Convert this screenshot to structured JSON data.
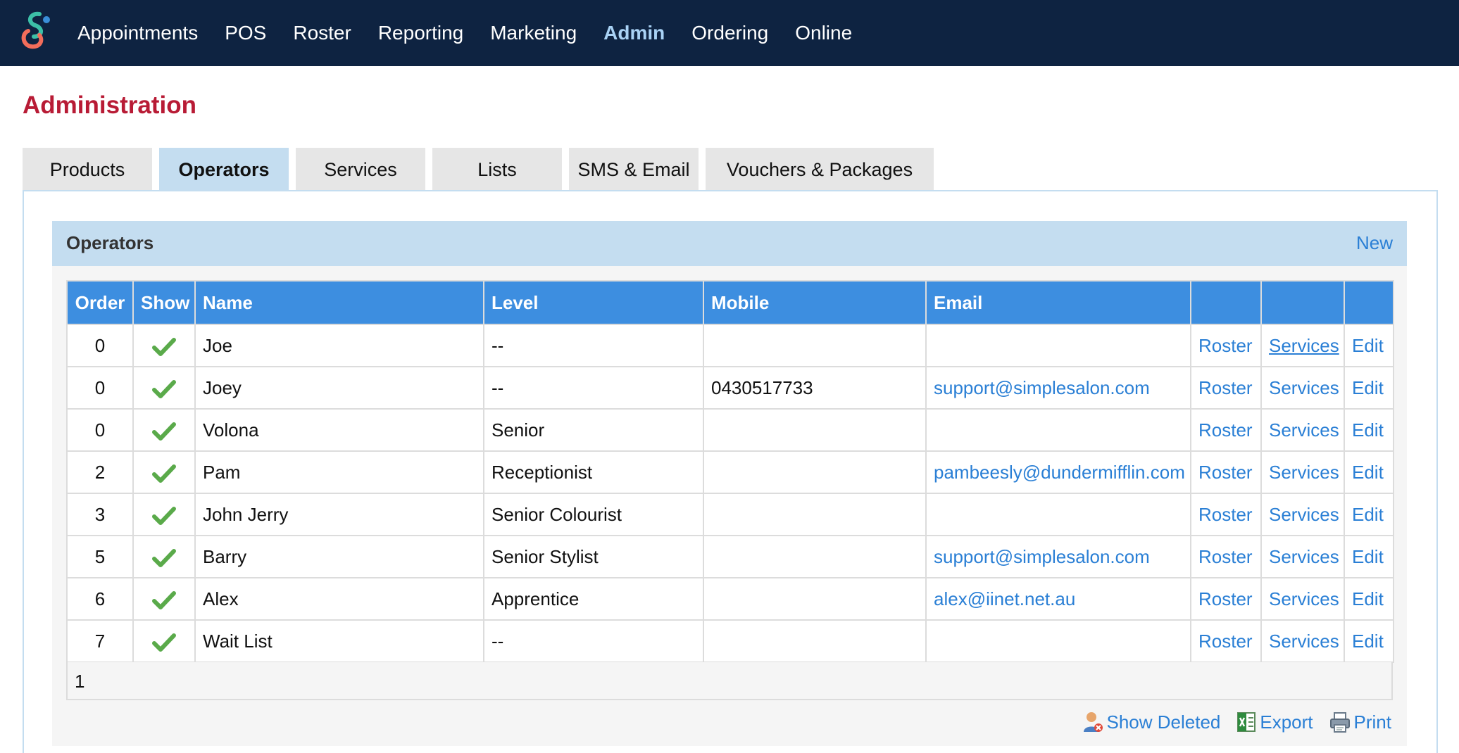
{
  "nav": {
    "items": [
      {
        "label": "Appointments",
        "name": "nav-appointments",
        "active": false
      },
      {
        "label": "POS",
        "name": "nav-pos",
        "active": false
      },
      {
        "label": "Roster",
        "name": "nav-roster",
        "active": false
      },
      {
        "label": "Reporting",
        "name": "nav-reporting",
        "active": false
      },
      {
        "label": "Marketing",
        "name": "nav-marketing",
        "active": false
      },
      {
        "label": "Admin",
        "name": "nav-admin",
        "active": true
      },
      {
        "label": "Ordering",
        "name": "nav-ordering",
        "active": false
      },
      {
        "label": "Online",
        "name": "nav-online",
        "active": false
      }
    ]
  },
  "page": {
    "title": "Administration"
  },
  "tabs": [
    {
      "label": "Products",
      "active": false
    },
    {
      "label": "Operators",
      "active": true
    },
    {
      "label": "Services",
      "active": false
    },
    {
      "label": "Lists",
      "active": false
    },
    {
      "label": "SMS & Email",
      "active": false
    },
    {
      "label": "Vouchers & Packages",
      "active": false
    }
  ],
  "panel": {
    "title": "Operators",
    "new_label": "New"
  },
  "table": {
    "headers": [
      "Order",
      "Show",
      "Name",
      "Level",
      "Mobile",
      "Email",
      "",
      "",
      ""
    ],
    "rows": [
      {
        "order": "0",
        "name": "Joe",
        "level": "--",
        "mobile": "",
        "email": "",
        "roster": "Roster",
        "services": "Services",
        "edit": "Edit"
      },
      {
        "order": "0",
        "name": "Joey",
        "level": "--",
        "mobile": "0430517733",
        "email": "support@simplesalon.com",
        "roster": "Roster",
        "services": "Services",
        "edit": "Edit"
      },
      {
        "order": "0",
        "name": "Volona",
        "level": "Senior",
        "mobile": "",
        "email": "",
        "roster": "Roster",
        "services": "Services",
        "edit": "Edit"
      },
      {
        "order": "2",
        "name": "Pam",
        "level": "Receptionist",
        "mobile": "",
        "email": "pambeesly@dundermifflin.com",
        "roster": "Roster",
        "services": "Services",
        "edit": "Edit"
      },
      {
        "order": "3",
        "name": "John Jerry",
        "level": "Senior Colourist",
        "mobile": "",
        "email": "",
        "roster": "Roster",
        "services": "Services",
        "edit": "Edit"
      },
      {
        "order": "5",
        "name": "Barry",
        "level": "Senior Stylist",
        "mobile": "",
        "email": "support@simplesalon.com",
        "roster": "Roster",
        "services": "Services",
        "edit": "Edit"
      },
      {
        "order": "6",
        "name": "Alex",
        "level": "Apprentice",
        "mobile": "",
        "email": "alex@iinet.net.au",
        "roster": "Roster",
        "services": "Services",
        "edit": "Edit"
      },
      {
        "order": "7",
        "name": "Wait List",
        "level": "--",
        "mobile": "",
        "email": "",
        "roster": "Roster",
        "services": "Services",
        "edit": "Edit"
      }
    ],
    "show_icon": "green-check-icon"
  },
  "pager": {
    "page": "1"
  },
  "footer": {
    "show_deleted": "Show Deleted",
    "export": "Export",
    "print": "Print"
  },
  "colors": {
    "nav_bg": "#0e2341",
    "nav_active": "#a9d2f5",
    "title": "#b81b35",
    "header_bg": "#3d8ee0",
    "panel_header": "#c4ddf0",
    "link": "#2a7fd5",
    "check": "#5aaa4a"
  }
}
